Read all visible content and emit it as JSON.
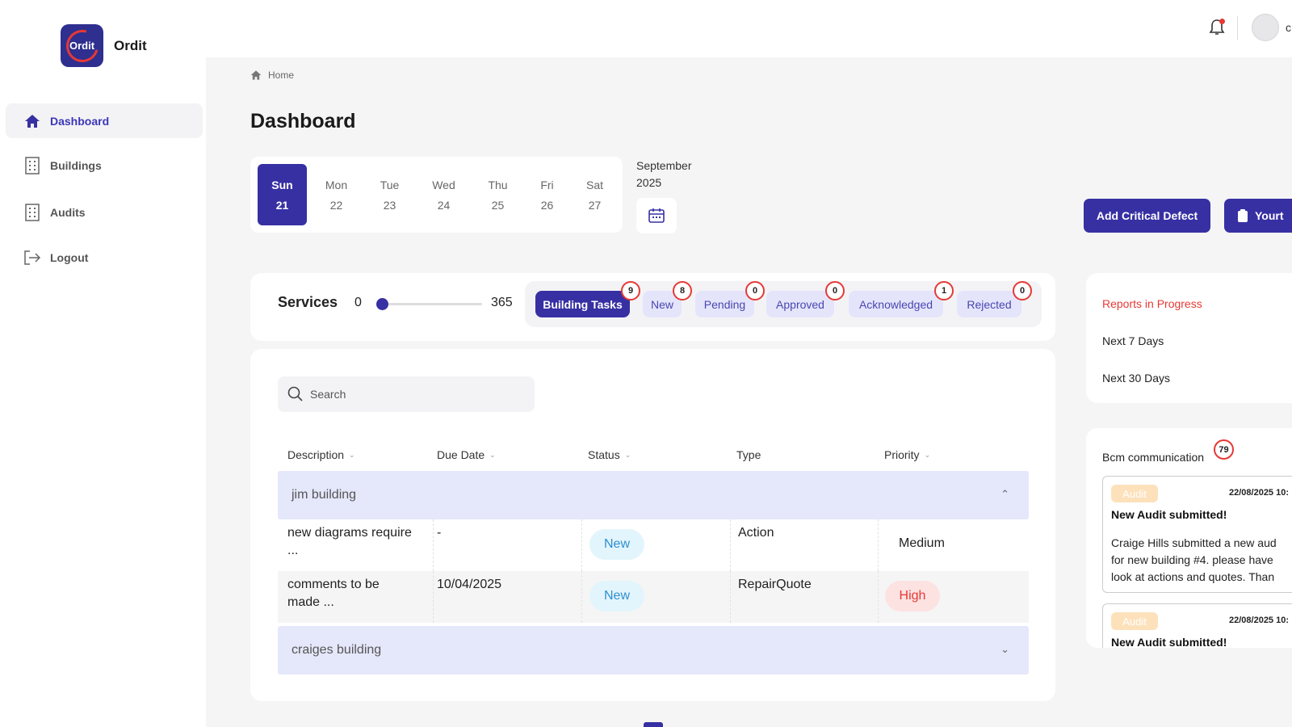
{
  "app": {
    "name": "Ordit",
    "logo_text": "Ordit"
  },
  "sidebar": {
    "items": [
      {
        "label": "Dashboard",
        "icon": "home-icon",
        "active": true
      },
      {
        "label": "Buildings",
        "icon": "building-icon"
      },
      {
        "label": "Audits",
        "icon": "building-icon"
      },
      {
        "label": "Logout",
        "icon": "logout-icon"
      }
    ]
  },
  "header": {
    "user_initial": "c"
  },
  "breadcrumb": {
    "home": "Home"
  },
  "page": {
    "title": "Dashboard"
  },
  "calendar": {
    "days": [
      {
        "name": "Sun",
        "date": "21",
        "active": true
      },
      {
        "name": "Mon",
        "date": "22"
      },
      {
        "name": "Tue",
        "date": "23"
      },
      {
        "name": "Wed",
        "date": "24"
      },
      {
        "name": "Thu",
        "date": "25"
      },
      {
        "name": "Fri",
        "date": "26"
      },
      {
        "name": "Sat",
        "date": "27"
      }
    ],
    "month": "September",
    "year": "2025"
  },
  "actions": {
    "add_critical_defect": "Add Critical Defect",
    "second_button": "Yourt"
  },
  "services": {
    "title": "Services",
    "range_min": "0",
    "range_max": "365",
    "slider_value": 0,
    "tabs": [
      {
        "label": "Building Tasks",
        "count": "9",
        "active": true
      },
      {
        "label": "New",
        "count": "8"
      },
      {
        "label": "Pending",
        "count": "0"
      },
      {
        "label": "Approved",
        "count": "0"
      },
      {
        "label": "Acknowledged",
        "count": "1"
      },
      {
        "label": "Rejected",
        "count": "0"
      }
    ]
  },
  "table": {
    "search_placeholder": "Search",
    "columns": [
      "Description",
      "Due Date",
      "Status",
      "Type",
      "Priority"
    ],
    "groups": [
      {
        "name": "jim building",
        "expanded": true,
        "rows": [
          {
            "description_1": "new diagrams require",
            "description_2": "...",
            "due": "-",
            "status": "New",
            "type": "Action",
            "priority": "Medium"
          },
          {
            "description_1": "comments to be",
            "description_2": "made ...",
            "due": "10/04/2025",
            "status": "New",
            "type": "RepairQuote",
            "priority": "High"
          }
        ]
      },
      {
        "name": "craiges building",
        "expanded": false
      }
    ]
  },
  "reports": {
    "title": "Reports in Progress",
    "items": [
      "Next 7 Days",
      "Next 30 Days"
    ]
  },
  "communication": {
    "title": "Bcm communication",
    "count": "79",
    "messages": [
      {
        "tag": "Audit",
        "date": "22/08/2025 10:",
        "title": "New Audit submitted!",
        "body": [
          "Craige Hills submitted a new aud",
          "for new building #4. please have",
          "look at actions and quotes. Than"
        ]
      },
      {
        "tag": "Audit",
        "date": "22/08/2025 10:",
        "title": "New Audit submitted!"
      }
    ]
  },
  "colors": {
    "primary": "#3730a3",
    "accent_red": "#e53935",
    "group_row": "#e5e7fb",
    "tag_orange": "#fde1bb"
  }
}
